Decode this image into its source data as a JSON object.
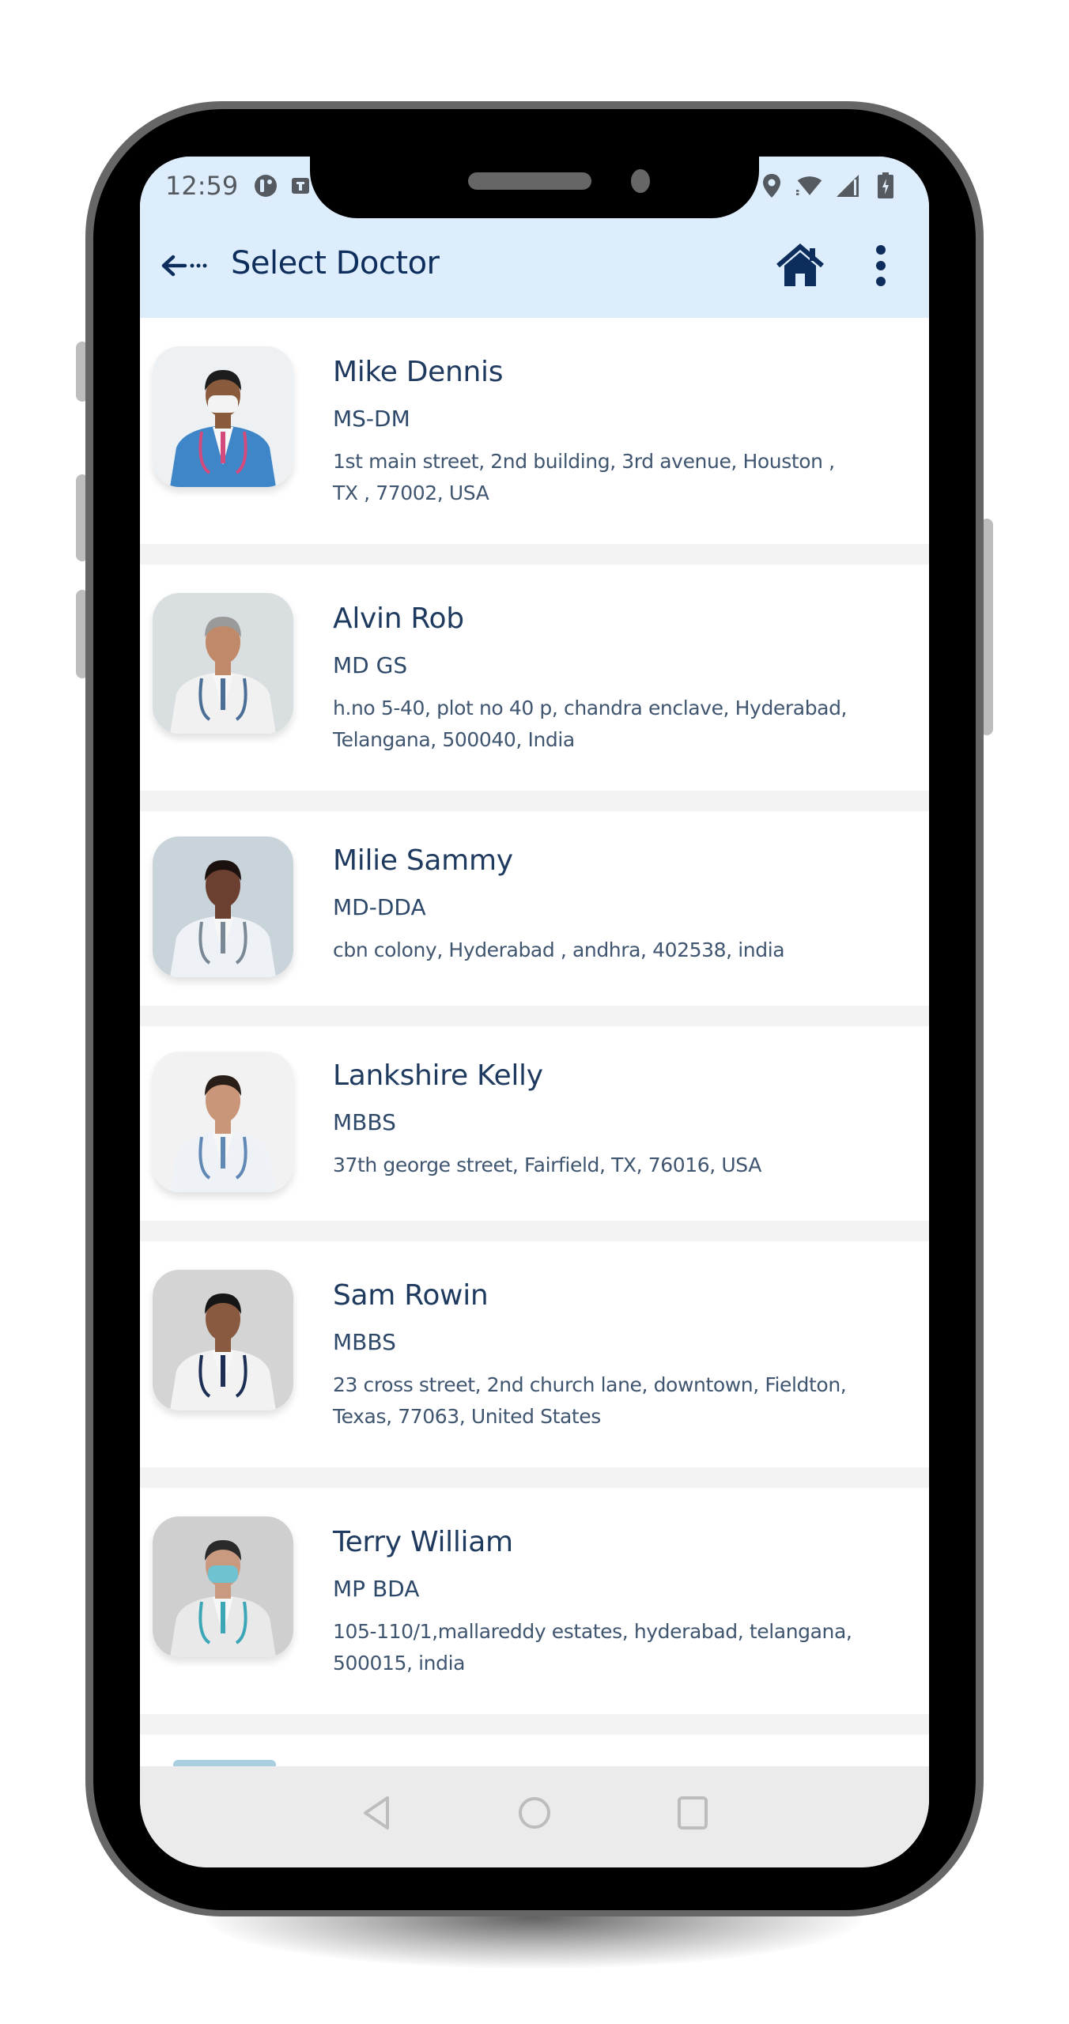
{
  "status_bar": {
    "time": "12:59",
    "left_icons": [
      "app-notification-icon",
      "app-notification-icon-2"
    ],
    "right_icons": [
      "location-icon",
      "wifi-icon",
      "signal-icon",
      "battery-charging-icon"
    ]
  },
  "app_bar": {
    "back_icon": "back-arrow-icon",
    "title": "Select Doctor",
    "home_icon": "home-icon",
    "more_icon": "more-vertical-icon"
  },
  "doctors": [
    {
      "name": "Mike Dennis",
      "degree": "MS-DM",
      "address_lines": [
        "1st main street, 2nd building, 3rd avenue, Houston ,",
        "TX , 77002, USA"
      ],
      "avatar_colors": {
        "bg": "#eef1f3",
        "coat": "#3f86c9",
        "skin": "#8a5a3c",
        "hair": "#1d1d1d",
        "accent": "#d34a7c",
        "mask": "#f3f3f3"
      }
    },
    {
      "name": "Alvin Rob",
      "degree": "MD GS",
      "address_lines": [
        "h.no 5-40, plot no 40 p, chandra enclave, Hyderabad,",
        "Telangana, 500040, India"
      ],
      "avatar_colors": {
        "bg": "#d9dee0",
        "coat": "#f1f1f1",
        "skin": "#c08a6a",
        "hair": "#9a9a9a",
        "accent": "#4b6e96",
        "mask": ""
      }
    },
    {
      "name": "Milie Sammy",
      "degree": "MD-DDA",
      "address_lines": [
        "cbn colony, Hyderabad , andhra, 402538, india"
      ],
      "avatar_colors": {
        "bg": "#c9d3da",
        "coat": "#eef2f6",
        "skin": "#6b4030",
        "hair": "#1b1210",
        "accent": "#7a8896",
        "mask": ""
      }
    },
    {
      "name": "Lankshire Kelly",
      "degree": "MBBS",
      "address_lines": [
        "37th george street, Fairfield, TX, 76016, USA"
      ],
      "avatar_colors": {
        "bg": "#f2f2f2",
        "coat": "#eef1f5",
        "skin": "#c9967a",
        "hair": "#2a1e18",
        "accent": "#5f88b5",
        "mask": ""
      }
    },
    {
      "name": "Sam Rowin",
      "degree": "MBBS",
      "address_lines": [
        "23 cross street, 2nd church lane, downtown, Fieldton,",
        "Texas, 77063, United States"
      ],
      "avatar_colors": {
        "bg": "#d4d4d4",
        "coat": "#f2f2f2",
        "skin": "#8a5a40",
        "hair": "#161616",
        "accent": "#1d2e55",
        "mask": ""
      }
    },
    {
      "name": "Terry William",
      "degree": "MP BDA",
      "address_lines": [
        "105-110/1,mallareddy estates, hyderabad, telangana,",
        "500015, india"
      ],
      "avatar_colors": {
        "bg": "#cfcfcf",
        "coat": "#e9e9e9",
        "skin": "#c99a80",
        "hair": "#2a2a2a",
        "accent": "#3aa6b6",
        "mask": "#6fc2cf"
      }
    }
  ],
  "system_nav": {
    "back_icon": "nav-back-icon",
    "home_icon": "nav-home-icon",
    "recents_icon": "nav-recents-icon"
  },
  "colors": {
    "app_bar_bg": "#deedfc",
    "title": "#0d2d5c",
    "name": "#1f3a5f",
    "separator": "#f3f3f3",
    "nav_bar_bg": "#ebebeb"
  }
}
